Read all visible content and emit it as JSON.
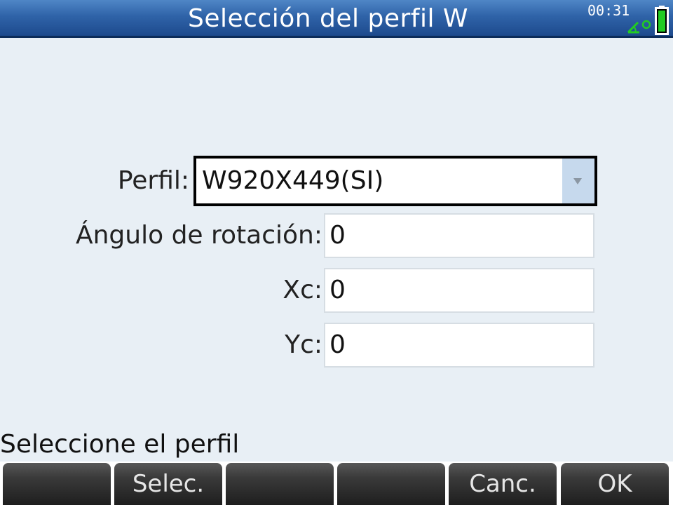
{
  "header": {
    "title": "Selección del perfil W",
    "time": "00:31",
    "angle_icon": "angle-mode-icon",
    "battery_icon": "battery-icon"
  },
  "form": {
    "profile": {
      "label": "Perfil:",
      "value": "W920X449(SI)",
      "arrow_icon": "dropdown-arrow-icon"
    },
    "rotation": {
      "label": "Ángulo de rotación:",
      "value": "0"
    },
    "xc": {
      "label": "Xc:",
      "value": "0"
    },
    "yc": {
      "label": "Yc:",
      "value": "0"
    }
  },
  "help_text": "Seleccione el perfil",
  "menu": [
    {
      "label": ""
    },
    {
      "label": "Selec."
    },
    {
      "label": ""
    },
    {
      "label": ""
    },
    {
      "label": "Canc."
    },
    {
      "label": "OK"
    }
  ],
  "colors": {
    "titlebar": "#2f63a8",
    "background": "#e8eff5",
    "menu_button": "#2a2a2a",
    "status_green": "#22cc22",
    "dropdown_arrow_bg": "#c6d9ed"
  }
}
